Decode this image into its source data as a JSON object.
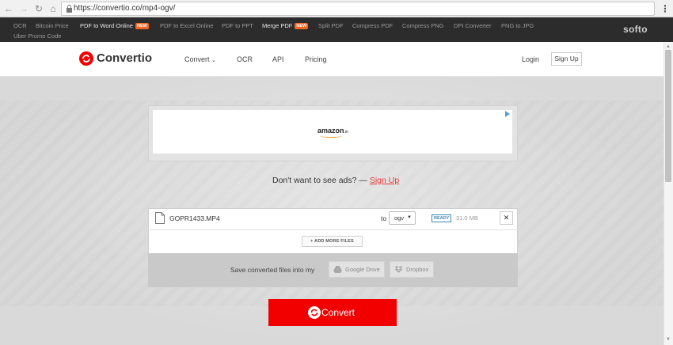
{
  "browser": {
    "url": "https://convertio.co/mp4-ogv/"
  },
  "softo_bar": {
    "links": [
      {
        "label": "OCR"
      },
      {
        "label": "Bitcoin Price"
      },
      {
        "label": "PDF to Word Online",
        "badge": "NEW"
      },
      {
        "label": "PDF to Excel Online"
      },
      {
        "label": "PDF to PPT"
      },
      {
        "label": "Merge PDF",
        "badge": "NEW"
      },
      {
        "label": "Split PDF"
      },
      {
        "label": "Compress PDF"
      },
      {
        "label": "Compress PNG"
      },
      {
        "label": "DPI Converter"
      },
      {
        "label": "PNG to JPG"
      },
      {
        "label": "Uber Promo Code"
      }
    ],
    "brand": "softo"
  },
  "header": {
    "logo_text": "Convertio",
    "nav": {
      "convert": "Convert",
      "ocr": "OCR",
      "api": "API",
      "pricing": "Pricing"
    },
    "login": "Login",
    "signup": "Sign Up"
  },
  "ad": {
    "brand": "amazon",
    "brand_suffix": ".in"
  },
  "no_ads": {
    "text": "Don't want to see ads? — ",
    "link": "Sign Up"
  },
  "file": {
    "name": "GOPR1433.MP4",
    "to_label": "to",
    "target_format": "ogv",
    "status": "READY",
    "size": "31.0 MB",
    "remove_glyph": "✕"
  },
  "add_more": "+ ADD MORE FILES",
  "save": {
    "label": "Save converted files into my",
    "google_drive": "Google Drive",
    "dropbox": "Dropbox"
  },
  "convert_button": "Convert",
  "colors": {
    "brand_red": "#f20000",
    "link_red": "#e53935",
    "ready_blue": "#3a8ab7",
    "new_badge": "#f26522"
  }
}
